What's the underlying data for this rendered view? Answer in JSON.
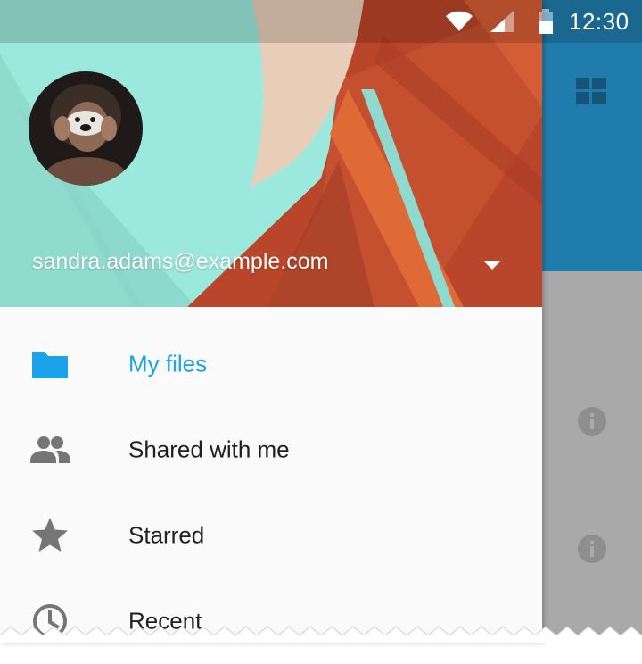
{
  "status_bar": {
    "time": "12:30",
    "icons": [
      "wifi-icon",
      "signal-icon",
      "battery-icon"
    ]
  },
  "drawer": {
    "account": {
      "email": "sandra.adams@example.com",
      "avatar": "profile-photo",
      "dropdown_icon": "arrow-drop-down-icon"
    },
    "items": [
      {
        "label": "My files",
        "icon": "folder-icon",
        "active": true
      },
      {
        "label": "Shared with me",
        "icon": "people-icon",
        "active": false
      },
      {
        "label": "Starred",
        "icon": "star-icon",
        "active": false
      },
      {
        "label": "Recent",
        "icon": "clock-icon",
        "active": false
      }
    ]
  },
  "background_app": {
    "toolbar_icon": "grid-view-icon",
    "row_icons": [
      "info-icon",
      "info-icon"
    ]
  },
  "colors": {
    "accent": "#1aa3e8",
    "toolbar": "#1f7cac",
    "scrim_content": "#a9a9a9",
    "drawer_bg": "#fafafa",
    "text_primary": "#212121",
    "icon_grey": "#757575"
  }
}
